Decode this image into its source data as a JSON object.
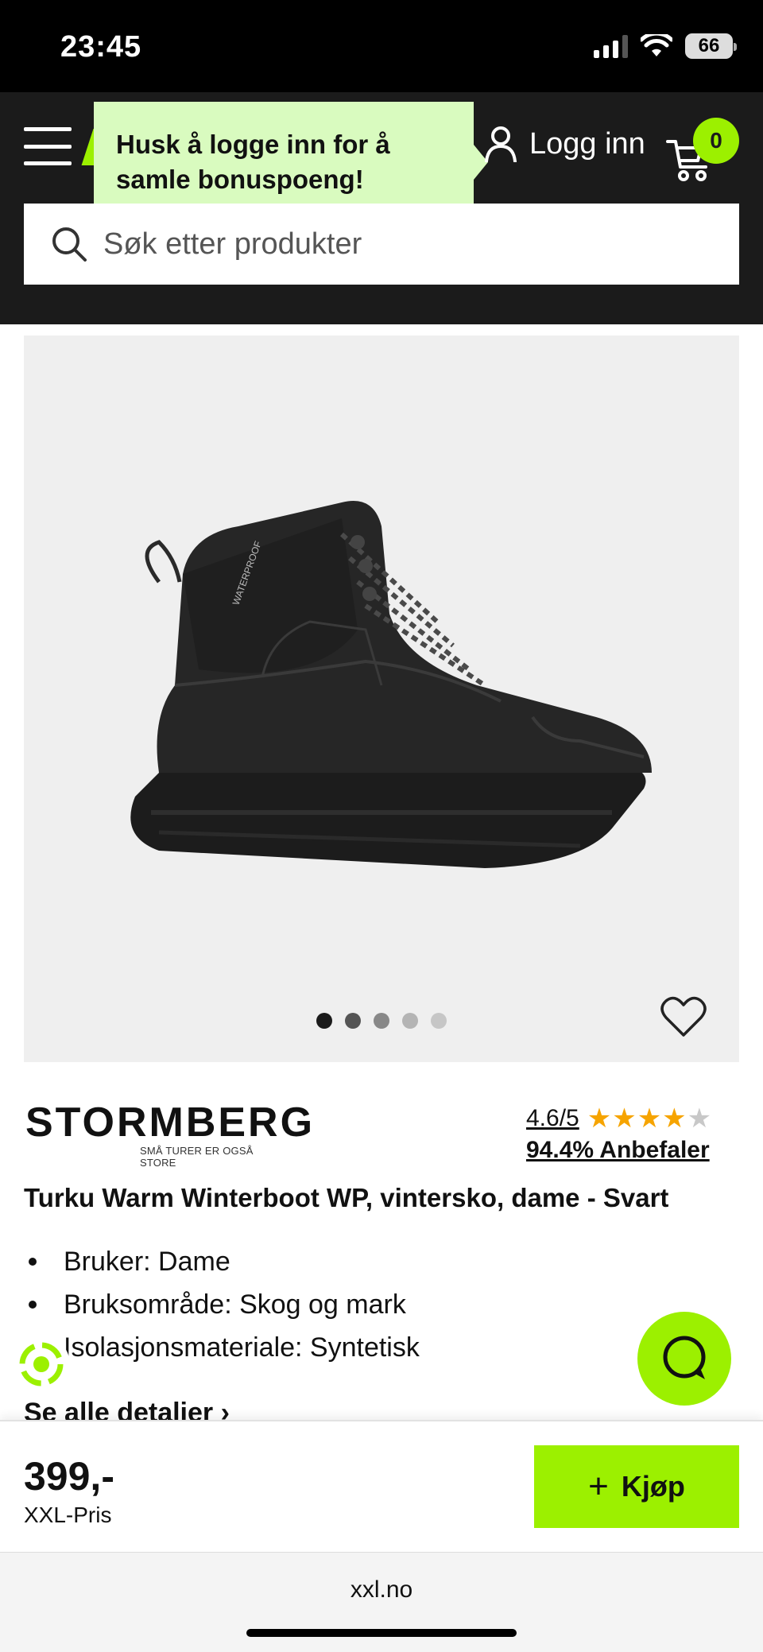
{
  "status": {
    "time": "23:45",
    "battery": "66"
  },
  "header": {
    "toast": "Husk å logge inn for å samle bonuspoeng!",
    "login_label": "Logg inn",
    "cart_count": "0"
  },
  "search": {
    "placeholder": "Søk etter produkter"
  },
  "gallery": {
    "image_count": 5,
    "active_index": 0,
    "image_text": "WATERPROOF"
  },
  "brand": {
    "name": "STORMBERG",
    "tagline": "SMÅ TURER ER OGSÅ STORE"
  },
  "rating": {
    "score": "4.6/5",
    "stars": 4.6,
    "recommend": "94.4% Anbefaler"
  },
  "product": {
    "title": "Turku Warm Winterboot WP, vintersko, dame - Svart",
    "bullets": [
      "Bruker: Dame",
      "Bruksområde: Skog og mark",
      "Isolasjonsmateriale: Syntetisk"
    ],
    "details_link": "Se alle detaljer"
  },
  "buybar": {
    "price": "399,-",
    "price_label": "XXL-Pris",
    "buy_label": "Kjøp"
  },
  "browser": {
    "url": "xxl.no"
  },
  "colors": {
    "accent": "#9cf000",
    "header_bg": "#1b1b1b",
    "toast_bg": "#d9fbbf",
    "star": "#f6a400"
  }
}
